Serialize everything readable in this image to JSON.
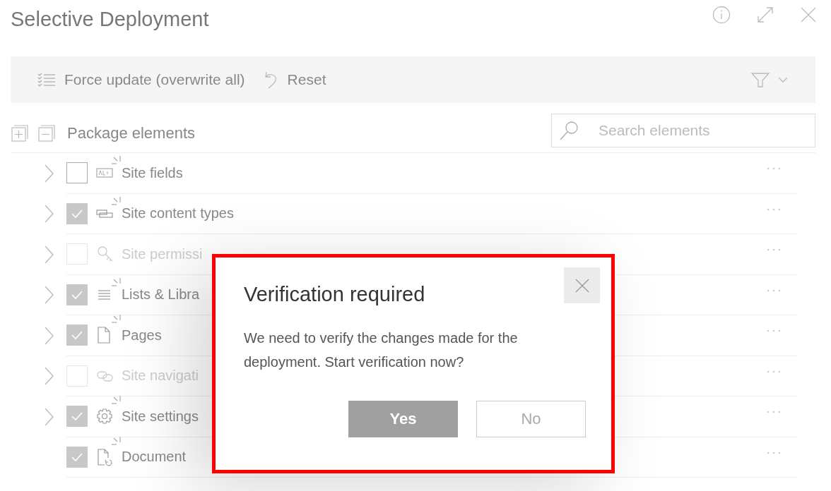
{
  "window": {
    "title": "Selective Deployment"
  },
  "toolbar": {
    "actions": [
      {
        "kind": "force",
        "label": "Force update (overwrite all)"
      },
      {
        "kind": "reset",
        "label": "Reset"
      }
    ]
  },
  "section": {
    "title": "Package elements"
  },
  "search": {
    "placeholder": "Search elements"
  },
  "rows": [
    {
      "kind": "fields",
      "label": "Site fields",
      "checked": false,
      "disabled": false,
      "expandable": true,
      "is_new": true
    },
    {
      "kind": "content-types",
      "label": "Site content types",
      "checked": true,
      "disabled": false,
      "expandable": true,
      "is_new": true
    },
    {
      "kind": "permissions",
      "label": "Site permissi",
      "checked": false,
      "disabled": true,
      "expandable": true,
      "is_new": false
    },
    {
      "kind": "lists",
      "label": "Lists & Libra",
      "checked": true,
      "disabled": false,
      "expandable": true,
      "is_new": true
    },
    {
      "kind": "pages",
      "label": "Pages",
      "checked": true,
      "disabled": false,
      "expandable": true,
      "is_new": true
    },
    {
      "kind": "navigation",
      "label": "Site navigati",
      "checked": false,
      "disabled": true,
      "expandable": true,
      "is_new": false
    },
    {
      "kind": "settings",
      "label": "Site settings",
      "checked": true,
      "disabled": false,
      "expandable": true,
      "is_new": true
    },
    {
      "kind": "document",
      "label": "Document",
      "checked": true,
      "disabled": false,
      "expandable": false,
      "is_new": true
    }
  ],
  "dialog": {
    "title": "Verification required",
    "message": "We need to verify the changes made for the deployment. Start verification now?",
    "buttons": [
      {
        "label": "Yes",
        "primary": true
      },
      {
        "label": "No",
        "primary": false
      }
    ]
  }
}
